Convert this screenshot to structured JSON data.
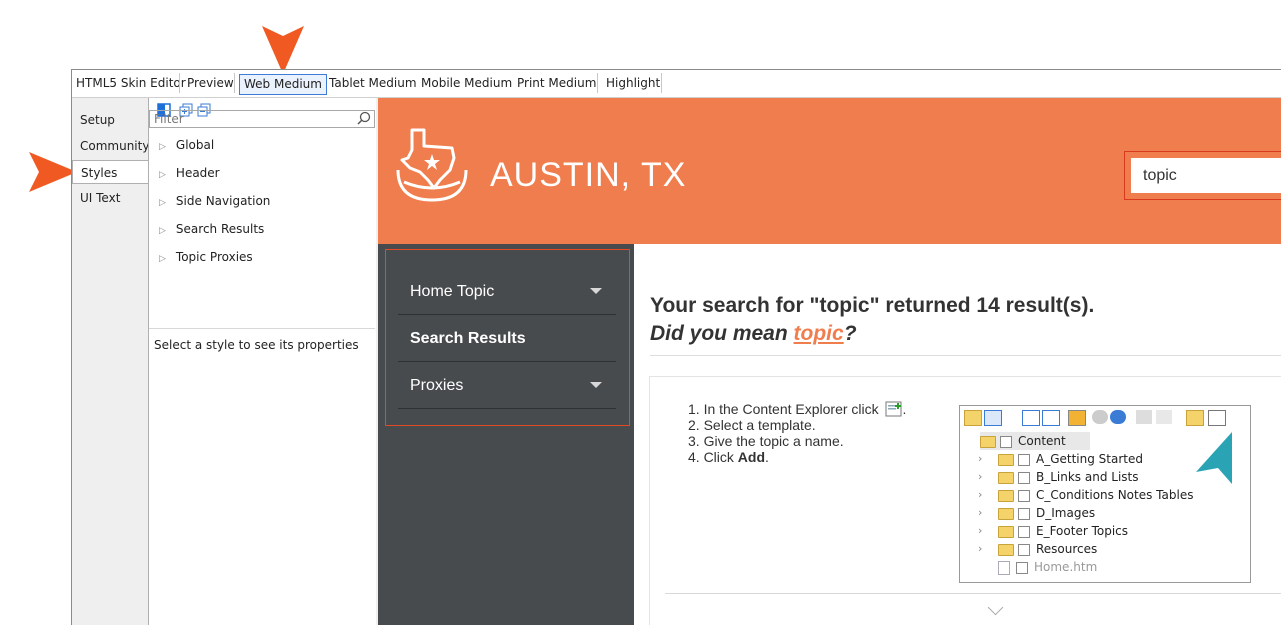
{
  "toolbar": {
    "tabs": [
      "HTML5 Skin Editor",
      "Preview",
      "Web Medium",
      "Tablet Medium",
      "Mobile Medium",
      "Print Medium",
      "Highlight"
    ],
    "active_index": 2
  },
  "side_tabs": [
    "Setup",
    "Community",
    "Styles",
    "UI Text"
  ],
  "side_tabs_active": "Styles",
  "panel": {
    "filter_placeholder": "Filter",
    "tree": [
      "Global",
      "Header",
      "Side Navigation",
      "Search Results",
      "Topic Proxies"
    ],
    "properties_hint": "Select a style to see its properties"
  },
  "preview": {
    "header_bg": "#f07d4d",
    "brand": "AUSTIN, TX",
    "search_value": "topic",
    "nav": [
      {
        "label": "Home Topic",
        "has_caret": true
      },
      {
        "label": "Search Results",
        "has_caret": false
      },
      {
        "label": "Proxies",
        "has_caret": true
      }
    ],
    "results_title": "Your search for \"topic\" returned 14 result(s).",
    "did_you_mean_prefix": "Did you mean ",
    "did_you_mean_link": "topic",
    "did_you_mean_suffix": "?",
    "steps": [
      "1. In the Content Explorer click",
      "2. Select a template.",
      "3. Give the topic a name.",
      "4. Click "
    ],
    "step4_bold": "Add",
    "explorer": {
      "root": "Content",
      "items": [
        "A_Getting Started",
        "B_Links and Lists",
        "C_Conditions Notes Tables",
        "D_Images",
        "E_Footer Topics",
        "Resources",
        "Home.htm"
      ]
    }
  },
  "annotation_colors": {
    "orange_arrow": "#f05a22",
    "teal_arrow": "#2aa4b5"
  }
}
